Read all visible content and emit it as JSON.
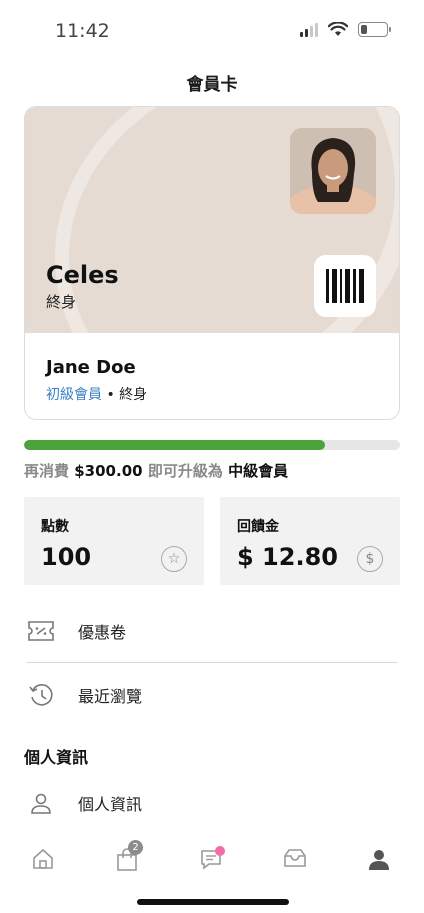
{
  "status_bar": {
    "time": "11:42"
  },
  "header": {
    "title": "會員卡"
  },
  "card": {
    "name": "Celes",
    "tier": "終身",
    "holder_name": "Jane Doe",
    "holder_level": "初級會員",
    "holder_separator": "•",
    "holder_duration": "終身"
  },
  "progress": {
    "fraction": 0.8,
    "prefix": "再消費",
    "amount": "$300.00",
    "middle": "即可升級為",
    "target": "中級會員",
    "color": "#4aa43a"
  },
  "stats": {
    "points_label": "點數",
    "points_value": "100",
    "rebate_label": "回饋金",
    "rebate_value": "$ 12.80"
  },
  "menu": {
    "coupons": "優惠卷",
    "recent": "最近瀏覽",
    "section_title": "個人資訊",
    "profile": "個人資訊"
  },
  "tab_bar": {
    "cart_count": "2",
    "icons": [
      "home-icon",
      "shopping-bag-icon",
      "chat-icon",
      "inbox-icon",
      "profile-icon"
    ]
  },
  "colors": {
    "accent_link": "#3a7fc4",
    "notification_dot": "#f06ea5"
  }
}
